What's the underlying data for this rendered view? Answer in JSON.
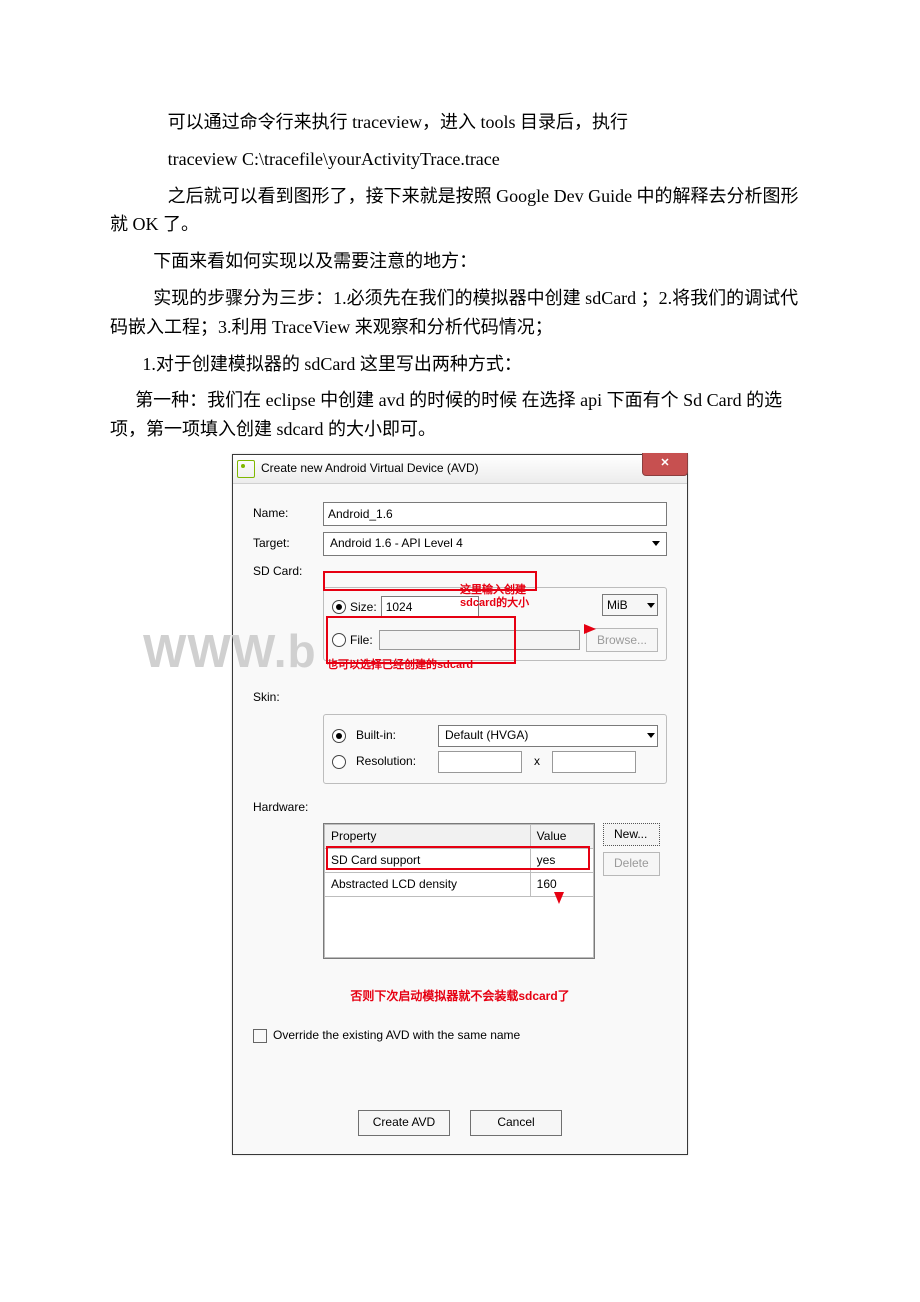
{
  "text": {
    "p1": "可以通过命令行来执行 traceview，进入 tools 目录后，执行",
    "p2": "traceview C:\\tracefile\\yourActivityTrace.trace",
    "p3": "之后就可以看到图形了，接下来就是按照 Google Dev Guide 中的解释去分析图形就 OK 了。",
    "p4": "下面来看如何实现以及需要注意的地方：",
    "p5": "实现的步骤分为三步：1.必须先在我们的模拟器中创建 sdCard ；2.将我们的调试代码嵌入工程；3.利用 TraceView 来观察和分析代码情况；",
    "p6": "1.对于创建模拟器的 sdCard 这里写出两种方式：",
    "p7": "第一种：我们在 eclipse 中创建 avd 的时候的时候 在选择 api 下面有个 Sd Card 的选项，第一项填入创建 sdcard 的大小即可。"
  },
  "dialog": {
    "title": "Create new Android Virtual Device (AVD)",
    "name_label": "Name:",
    "name_value": "Android_1.6",
    "target_label": "Target:",
    "target_value": "Android 1.6 - API Level 4",
    "sdcard_label": "SD Card:",
    "size_label": "Size:",
    "size_value": "1024",
    "size_unit": "MiB",
    "file_label": "File:",
    "browse": "Browse...",
    "skin_label": "Skin:",
    "builtin_label": "Built-in:",
    "builtin_value": "Default (HVGA)",
    "resolution_label": "Resolution:",
    "x_sep": "x",
    "hw_label": "Hardware:",
    "hw_header_prop": "Property",
    "hw_header_val": "Value",
    "hw_rows": [
      {
        "prop": "SD Card support",
        "val": "yes"
      },
      {
        "prop": "Abstracted LCD density",
        "val": "160"
      }
    ],
    "new_btn": "New...",
    "delete_btn": "Delete",
    "override": "Override the existing AVD with the same name",
    "create": "Create AVD",
    "cancel": "Cancel",
    "annot_size_1": "这里输入创建",
    "annot_size_2": "sdcard的大小",
    "annot_file": "也可以选择已经创建的sdcard",
    "annot_hw": "否则下次启动模拟器就不会装载sdcard了",
    "close_x": "✕"
  },
  "watermark": "WWW.b"
}
